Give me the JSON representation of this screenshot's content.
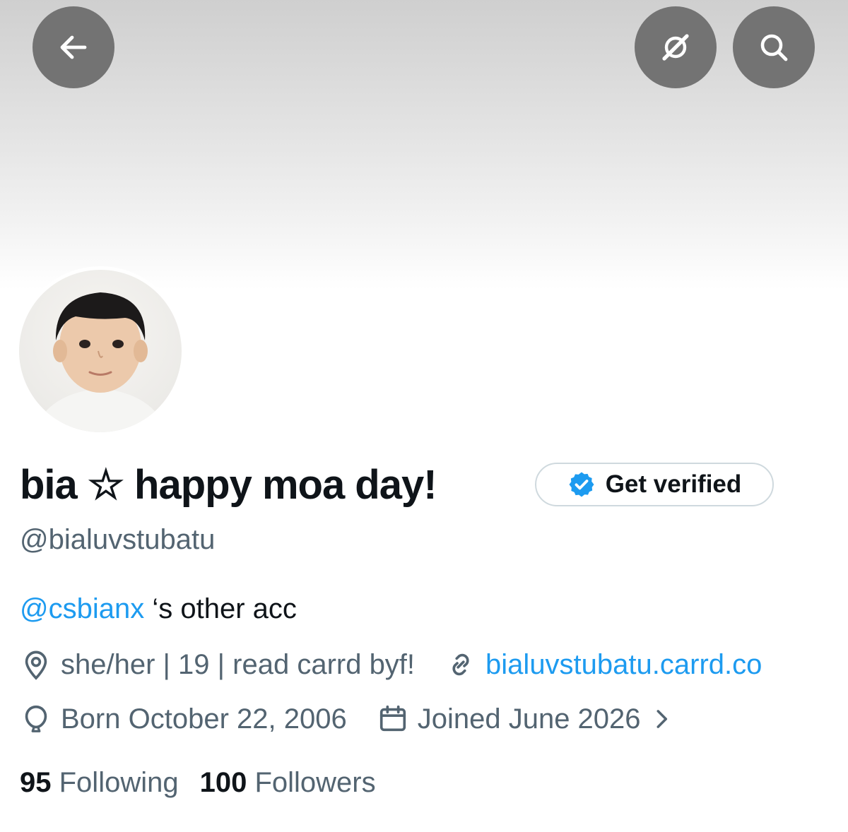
{
  "profile": {
    "display_name": "bia ☆ happy moa day!",
    "handle": "@bialuvstubatu",
    "get_verified_label": "Get verified",
    "bio": {
      "mention": "@csbianx",
      "text": " ‘s other acc"
    },
    "location": "she/her | 19 | read carrd byf!",
    "website": "bialuvstubatu.carrd.co",
    "birthday": "Born October 22, 2006",
    "joined": "Joined June 2026",
    "following_count": "95",
    "following_label": "Following",
    "followers_count": "100",
    "followers_label": "Followers"
  },
  "icons": {
    "back": "arrow-left-icon",
    "grok": "grok-icon",
    "search": "search-icon",
    "verified": "verified-badge-icon",
    "location": "location-pin-icon",
    "link": "link-icon",
    "birthday": "balloon-icon",
    "calendar": "calendar-icon",
    "chevron": "chevron-right-icon"
  },
  "colors": {
    "accent": "#1d9bf0",
    "secondary_text": "#536471",
    "primary_text": "#0f1419"
  }
}
